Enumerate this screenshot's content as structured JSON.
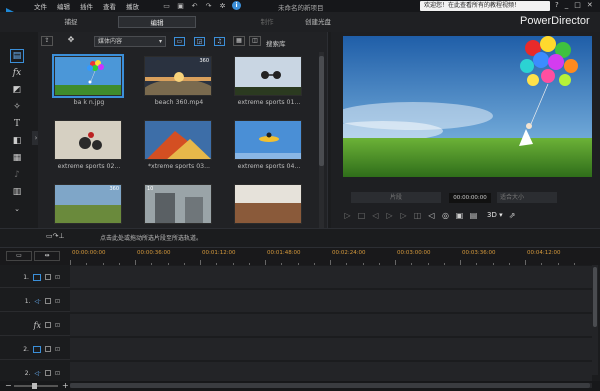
{
  "menu": [
    "文件",
    "编辑",
    "插件",
    "查看",
    "播放"
  ],
  "project_title": "未命名的新项目",
  "notice": "欢迎您！在此查看所有的教程视频！",
  "window_controls": [
    "?",
    "_",
    "□",
    "✕"
  ],
  "title_icons": [
    "folder-open-icon",
    "save-icon",
    "undo-icon",
    "redo-icon",
    "settings-icon",
    "info-icon"
  ],
  "modes": {
    "capture": "捕捉",
    "edit": "编辑",
    "produce": "制作",
    "disc": "创建光盘"
  },
  "brand": "PowerDirector",
  "library": {
    "media_select": "媒体内容",
    "search_label": "搜索库",
    "items": [
      {
        "caption": "ba  k n.jpg",
        "selected": true
      },
      {
        "caption": "beach 360.mp4",
        "badge": "360"
      },
      {
        "caption": "extreme sports 01..."
      },
      {
        "caption": "extreme sports 02..."
      },
      {
        "caption": "*xtreme sports 03..."
      },
      {
        "caption": "extreme sports 04..."
      },
      {
        "caption": "",
        "badge": "360"
      },
      {
        "caption": "",
        "badge": "10"
      },
      {
        "caption": ""
      }
    ]
  },
  "preview": {
    "clip_button": "片段",
    "timecode": "00:00:00:00",
    "fit_select": "适合大小",
    "label_3d": "3D ▾"
  },
  "timeline": {
    "hint": "点击此处或拖动所选片段至所选轨道。",
    "ruler_ticks": [
      "00:00:00:00",
      "00:00:36:00",
      "00:01:12:00",
      "00:01:48:00",
      "00:02:24:00",
      "00:03:00:00",
      "00:03:36:00",
      "00:04:12:00"
    ],
    "tracks": [
      {
        "num": "1.",
        "type": "video"
      },
      {
        "num": "1.",
        "type": "audio"
      },
      {
        "num": "",
        "type": "fx"
      },
      {
        "num": "2.",
        "type": "video"
      },
      {
        "num": "2.",
        "type": "audio"
      }
    ]
  }
}
